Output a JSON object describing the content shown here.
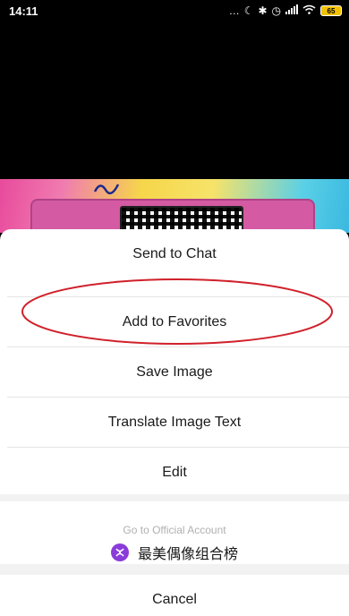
{
  "status_bar": {
    "time": "14:11",
    "icons": [
      "more-dots-icon",
      "moon-icon",
      "bluetooth-icon",
      "alarm-icon",
      "signal-icon",
      "wifi-icon",
      "battery-icon"
    ],
    "battery_level": "65"
  },
  "action_sheet": {
    "items": [
      {
        "label": "Send to Chat"
      },
      {
        "label": "Add to Favorites"
      },
      {
        "label": "Save Image"
      },
      {
        "label": "Translate Image Text"
      },
      {
        "label": "Edit"
      }
    ],
    "official_account": {
      "caption": "Go to Official Account",
      "name": "最美偶像组合榜"
    },
    "cancel_label": "Cancel"
  },
  "colors": {
    "highlight_ellipse": "#d0202a",
    "account_avatar": "#8b3bd9",
    "battery": "#f2c100"
  }
}
